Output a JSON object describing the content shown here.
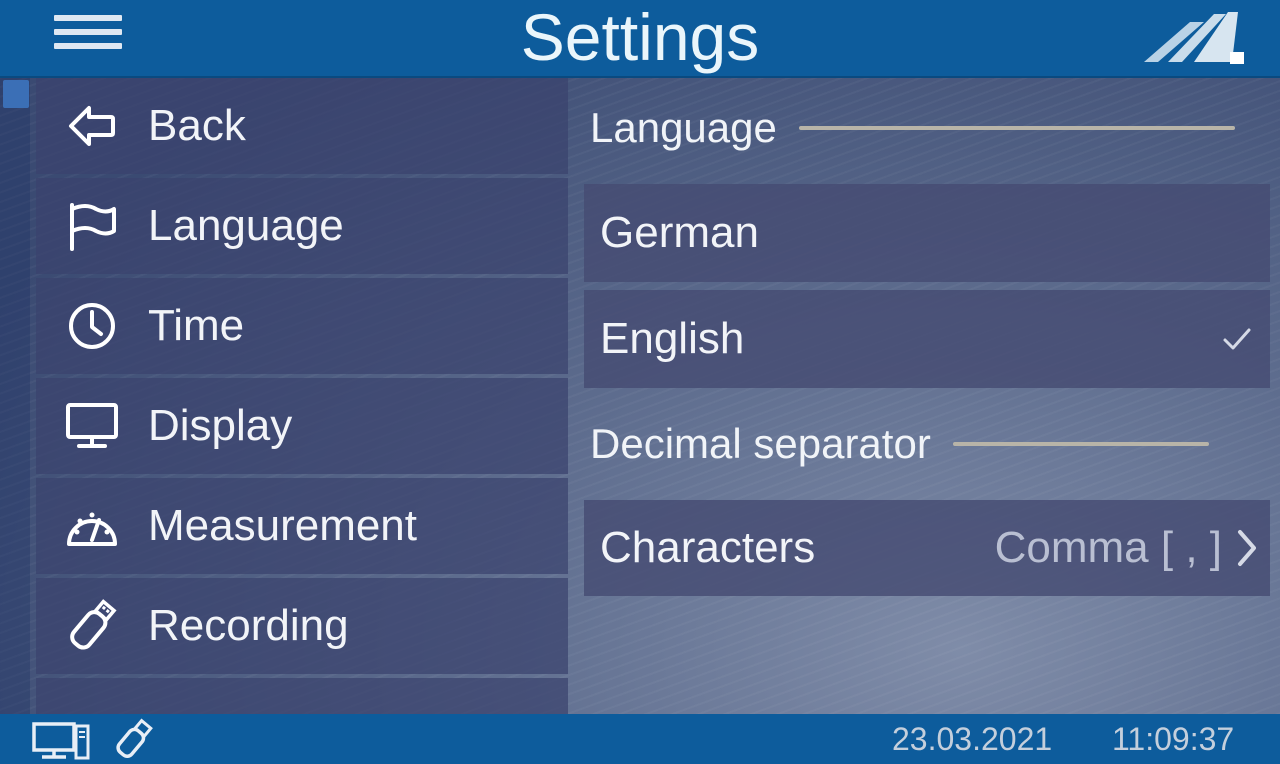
{
  "header": {
    "title": "Settings",
    "menu_icon": "hamburger-menu-icon",
    "logo": "brand-logo",
    "color": "#0d5c9c"
  },
  "sidebar": {
    "items": [
      {
        "label": "Back",
        "icon": "back-arrow-icon"
      },
      {
        "label": "Language",
        "icon": "flag-icon",
        "selected": true
      },
      {
        "label": "Time",
        "icon": "clock-icon"
      },
      {
        "label": "Display",
        "icon": "monitor-icon"
      },
      {
        "label": "Measurement",
        "icon": "gauge-icon"
      },
      {
        "label": "Recording",
        "icon": "usb-stick-icon"
      }
    ]
  },
  "main": {
    "language_section": {
      "title": "Language",
      "options": [
        {
          "label": "German",
          "selected": false
        },
        {
          "label": "English",
          "selected": true,
          "icon": "check-icon"
        }
      ]
    },
    "decimal_section": {
      "title": "Decimal separator",
      "characters": {
        "label": "Characters",
        "value": "Comma [ , ]",
        "icon": "chevron-right-icon"
      }
    }
  },
  "statusbar": {
    "icons": [
      "pc-connection-icon",
      "usb-stick-icon"
    ],
    "date": "23.03.2021",
    "time": "11:09:37"
  }
}
